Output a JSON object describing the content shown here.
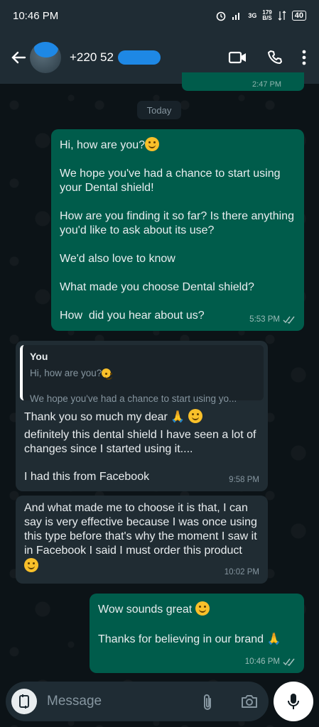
{
  "status_bar": {
    "time": "10:46 PM",
    "network_speed": "179\nB/S",
    "signal_label": "3G",
    "battery": "40"
  },
  "header": {
    "contact_name": "+220 52",
    "icons": [
      "back-arrow-icon",
      "video-call-icon",
      "phone-icon",
      "more-options-icon"
    ]
  },
  "chat": {
    "previous_message_time": "2:47 PM",
    "date_divider": "Today",
    "messages": [
      {
        "direction": "outgoing",
        "lines": [
          "Hi, how are you?",
          "",
          "We hope you've had a chance to start using your Dental shield!",
          "",
          "How are you finding it so far? Is there anything you'd like to ask about its use?",
          "",
          "We'd also love to know",
          "",
          "What made you choose Dental shield?",
          "",
          "How  did you hear about us?"
        ],
        "time": "5:53 PM",
        "status": "read"
      },
      {
        "direction": "incoming",
        "quote": {
          "author": "You",
          "line1": "Hi, how are you?",
          "line2": "We hope you've had a chance to start using yo..."
        },
        "text": "Thank you so much my dear",
        "text2": "definitely this dental shield I have seen a lot of changes since I started using it....",
        "text3": "I had this from Facebook",
        "time": "9:58 PM"
      },
      {
        "direction": "incoming",
        "text": "And what made me to choose it is that, I can say is very effective because I was once using this type before that's why the moment I saw it in Facebook I said I must order this product",
        "time": "10:02 PM"
      },
      {
        "direction": "outgoing",
        "text": "Wow sounds great",
        "text2": "Thanks for believing in our brand",
        "time": "10:46 PM",
        "status": "read"
      }
    ]
  },
  "composer": {
    "placeholder": "Message",
    "icons": [
      "emoji-sticker-icon",
      "attach-icon",
      "camera-icon",
      "microphone-icon"
    ]
  },
  "colors": {
    "outgoing_bubble": "#005c4b",
    "incoming_bubble": "#202c33",
    "header": "#1f2c34",
    "background": "#0b1014"
  }
}
